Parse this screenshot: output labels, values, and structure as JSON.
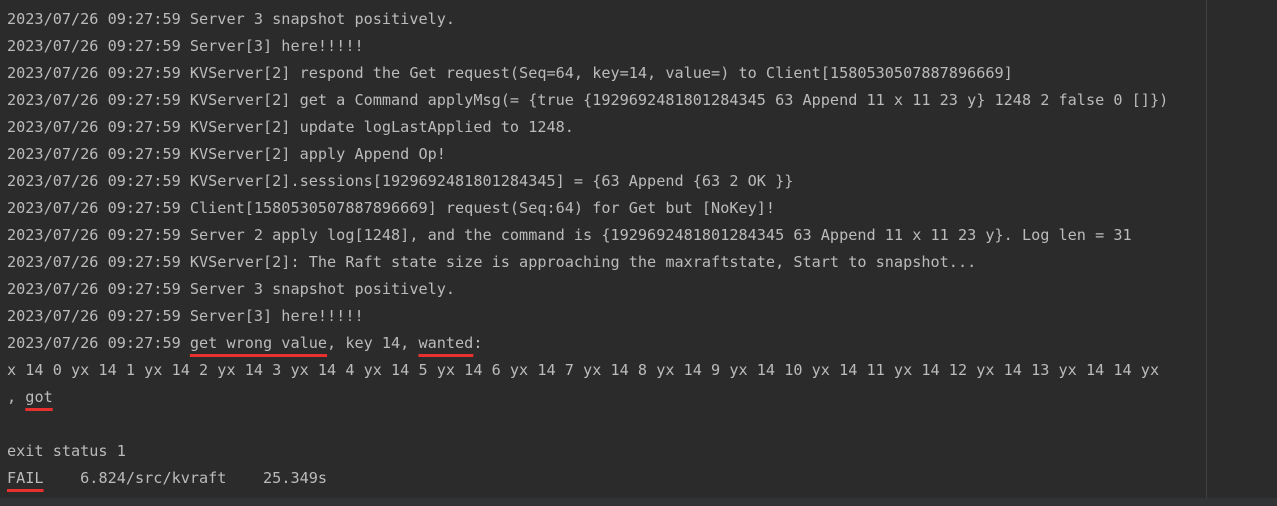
{
  "console": {
    "lines": [
      "2023/07/26 09:27:59 Server 3 snapshot positively.",
      "2023/07/26 09:27:59 Server[3] here!!!!!",
      "2023/07/26 09:27:59 KVServer[2] respond the Get request(Seq=64, key=14, value=) to Client[1580530507887896669]",
      "2023/07/26 09:27:59 KVServer[2] get a Command applyMsg(= {true {1929692481801284345 63 Append 11 x 11 23 y} 1248 2 false 0 []})",
      "2023/07/26 09:27:59 KVServer[2] update logLastApplied to 1248.",
      "2023/07/26 09:27:59 KVServer[2] apply Append Op!",
      "2023/07/26 09:27:59 KVServer[2].sessions[1929692481801284345] = {63 Append {63 2 OK }}",
      "2023/07/26 09:27:59 Client[1580530507887896669] request(Seq:64) for Get but [NoKey]!",
      "2023/07/26 09:27:59 Server 2 apply log[1248], and the command is {1929692481801284345 63 Append 11 x 11 23 y}. Log len = 31",
      "2023/07/26 09:27:59 KVServer[2]: The Raft state size is approaching the maxraftstate, Start to snapshot...",
      "2023/07/26 09:27:59 Server 3 snapshot positively.",
      "2023/07/26 09:27:59 Server[3] here!!!!!"
    ],
    "error_line": {
      "prefix": "2023/07/26 09:27:59 ",
      "wrong_value": "get wrong value",
      "middle": ", key 14, ",
      "wanted": "wanted",
      "suffix": ":"
    },
    "values_line": "x 14 0 yx 14 1 yx 14 2 yx 14 3 yx 14 4 yx 14 5 yx 14 6 yx 14 7 yx 14 8 yx 14 9 yx 14 10 yx 14 11 yx 14 12 yx 14 13 yx 14 14 yx",
    "got_line": {
      "prefix": ", ",
      "got": "got"
    },
    "exit_status": "exit status 1",
    "fail_line": {
      "fail": "FAIL",
      "rest": "    6.824/src/kvraft    25.349s"
    }
  },
  "colors": {
    "background": "#2b2b2b",
    "text": "#bbbbbb",
    "underline": "#e8312f"
  }
}
